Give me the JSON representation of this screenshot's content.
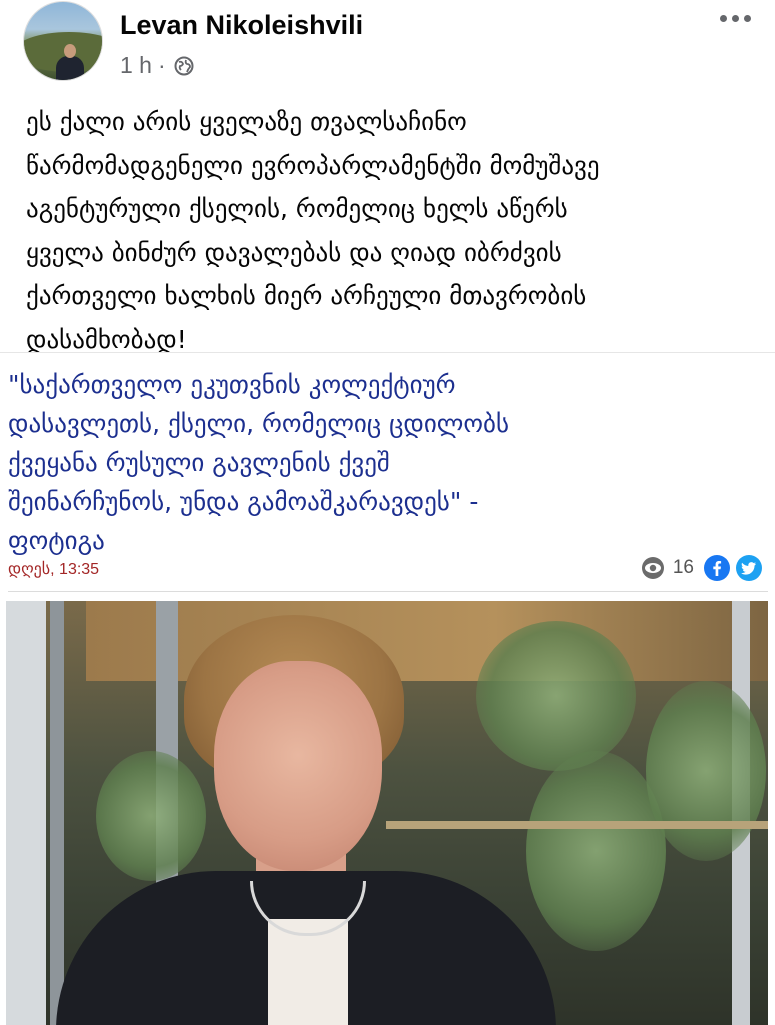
{
  "post": {
    "author": "Levan Nikoleishvili",
    "time": "1 h",
    "separator": "·",
    "lines": [
      "ეს ქალი არის ყველაზე თვალსაჩინო",
      "წარმომადგენელი ევროპარლამენტში მომუშავე",
      "აგენტურული ქსელის, რომელიც ხელს აწერს",
      "ყველა ბინძურ დავალებას და ღიად იბრძვის",
      "ქართველი ხალხის მიერ არჩეული მთავრობის",
      "დასამხობად!"
    ]
  },
  "article": {
    "title_lines": [
      "\"საქართველო ეკუთვნის კოლექტიურ",
      "დასავლეთს, ქსელი, რომელიც ცდილობს",
      "ქვეყანა რუსული გავლენის ქვეშ",
      "შეინარჩუნოს, უნდა გამოაშკარავდეს\" -",
      "ფოტიგა"
    ],
    "date": "დღეს, 13:35",
    "views": "16"
  },
  "icons": {
    "more": "more-options-icon",
    "privacy": "globe-icon",
    "views": "eye-icon",
    "facebook": "facebook-icon",
    "twitter": "twitter-icon"
  },
  "colors": {
    "title": "#1c2f8f",
    "date": "#a32626",
    "facebook": "#1877f2",
    "twitter": "#1da1f2"
  }
}
